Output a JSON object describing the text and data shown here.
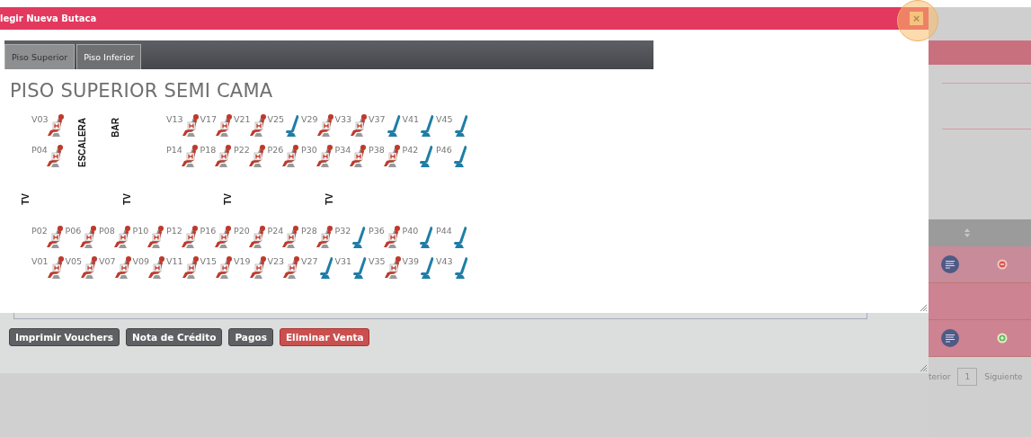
{
  "dialog": {
    "title": "legir Nueva Butaca",
    "close_label": "×"
  },
  "tabs": [
    {
      "label": "Piso Superior",
      "selected": true
    },
    {
      "label": "Piso Inferior",
      "selected": false
    }
  ],
  "deck_title": "PISO SUPERIOR SEMI CAMA",
  "upper_block": [
    {
      "kind": "seats",
      "seats": [
        {
          "label": "V03",
          "occupied": true
        },
        {
          "label": "P04",
          "occupied": true
        }
      ]
    },
    {
      "kind": "sign",
      "text": "ESCALERA"
    },
    {
      "kind": "sign",
      "text": "BAR"
    },
    {
      "kind": "gap"
    },
    {
      "kind": "seats",
      "seats": [
        {
          "label": "V13",
          "occupied": true
        },
        {
          "label": "P14",
          "occupied": true
        }
      ]
    },
    {
      "kind": "seats",
      "seats": [
        {
          "label": "V17",
          "occupied": true
        },
        {
          "label": "P18",
          "occupied": true
        }
      ]
    },
    {
      "kind": "seats",
      "seats": [
        {
          "label": "V21",
          "occupied": true
        },
        {
          "label": "P22",
          "occupied": true
        }
      ]
    },
    {
      "kind": "seats",
      "seats": [
        {
          "label": "V25",
          "occupied": false
        },
        {
          "label": "P26",
          "occupied": true
        }
      ]
    },
    {
      "kind": "seats",
      "seats": [
        {
          "label": "V29",
          "occupied": true
        },
        {
          "label": "P30",
          "occupied": true
        }
      ]
    },
    {
      "kind": "seats",
      "seats": [
        {
          "label": "V33",
          "occupied": true
        },
        {
          "label": "P34",
          "occupied": true
        }
      ]
    },
    {
      "kind": "seats",
      "seats": [
        {
          "label": "V37",
          "occupied": false
        },
        {
          "label": "P38",
          "occupied": true
        }
      ]
    },
    {
      "kind": "seats",
      "seats": [
        {
          "label": "V41",
          "occupied": false
        },
        {
          "label": "P42",
          "occupied": false
        }
      ]
    },
    {
      "kind": "seats",
      "seats": [
        {
          "label": "V45",
          "occupied": false
        },
        {
          "label": "P46",
          "occupied": false
        }
      ]
    }
  ],
  "tv_row": [
    {
      "kind": "tv",
      "text": "TV"
    },
    {
      "kind": "gap"
    },
    {
      "kind": "gap"
    },
    {
      "kind": "tv",
      "text": "TV"
    },
    {
      "kind": "gap"
    },
    {
      "kind": "gap"
    },
    {
      "kind": "tv",
      "text": "TV"
    },
    {
      "kind": "gap"
    },
    {
      "kind": "gap"
    },
    {
      "kind": "tv",
      "text": "TV"
    }
  ],
  "lower_block": [
    {
      "kind": "seats",
      "seats": [
        {
          "label": "P02",
          "occupied": true
        },
        {
          "label": "V01",
          "occupied": true
        }
      ]
    },
    {
      "kind": "seats",
      "seats": [
        {
          "label": "P06",
          "occupied": true
        },
        {
          "label": "V05",
          "occupied": true
        }
      ]
    },
    {
      "kind": "seats",
      "seats": [
        {
          "label": "P08",
          "occupied": true
        },
        {
          "label": "V07",
          "occupied": true
        }
      ]
    },
    {
      "kind": "seats",
      "seats": [
        {
          "label": "P10",
          "occupied": true
        },
        {
          "label": "V09",
          "occupied": true
        }
      ]
    },
    {
      "kind": "seats",
      "seats": [
        {
          "label": "P12",
          "occupied": true
        },
        {
          "label": "V11",
          "occupied": true
        }
      ]
    },
    {
      "kind": "seats",
      "seats": [
        {
          "label": "P16",
          "occupied": true
        },
        {
          "label": "V15",
          "occupied": true
        }
      ]
    },
    {
      "kind": "seats",
      "seats": [
        {
          "label": "P20",
          "occupied": true
        },
        {
          "label": "V19",
          "occupied": true
        }
      ]
    },
    {
      "kind": "seats",
      "seats": [
        {
          "label": "P24",
          "occupied": true
        },
        {
          "label": "V23",
          "occupied": true
        }
      ]
    },
    {
      "kind": "seats",
      "seats": [
        {
          "label": "P28",
          "occupied": true
        },
        {
          "label": "V27",
          "occupied": false
        }
      ]
    },
    {
      "kind": "seats",
      "seats": [
        {
          "label": "P32",
          "occupied": false
        },
        {
          "label": "V31",
          "occupied": false
        }
      ]
    },
    {
      "kind": "seats",
      "seats": [
        {
          "label": "P36",
          "occupied": true
        },
        {
          "label": "V35",
          "occupied": true
        }
      ]
    },
    {
      "kind": "seats",
      "seats": [
        {
          "label": "P40",
          "occupied": false
        },
        {
          "label": "V39",
          "occupied": false
        }
      ]
    },
    {
      "kind": "seats",
      "seats": [
        {
          "label": "P44",
          "occupied": false
        },
        {
          "label": "V43",
          "occupied": false
        }
      ]
    }
  ],
  "footer_buttons": [
    {
      "label": "Imprimir Vouchers",
      "kind": "default"
    },
    {
      "label": "Nota de Crédito",
      "kind": "default"
    },
    {
      "label": "Pagos",
      "kind": "default"
    },
    {
      "label": "Eliminar Venta",
      "kind": "danger"
    }
  ],
  "side_panel": {
    "rows": [
      {
        "kind": "remove"
      },
      {
        "kind": "empty"
      },
      {
        "kind": "add"
      }
    ],
    "pagination": {
      "previous": "terior",
      "page": "1",
      "next": "Siguiente"
    }
  }
}
